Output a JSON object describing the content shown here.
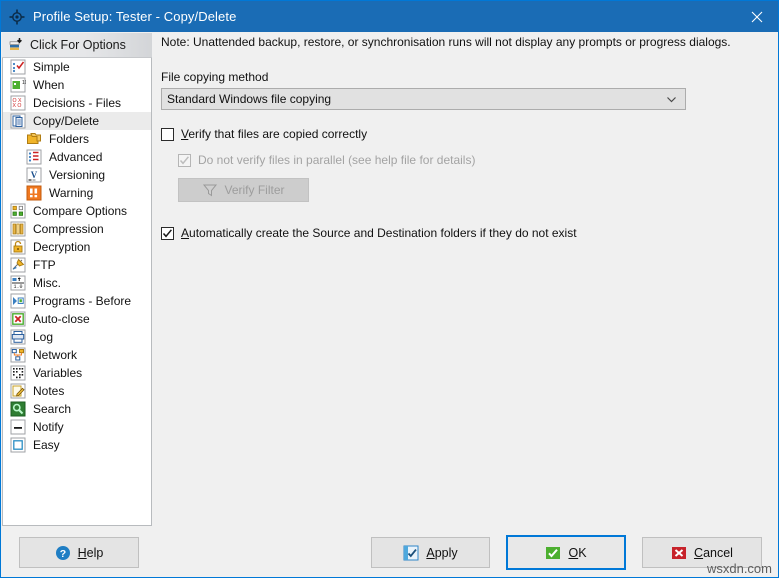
{
  "window": {
    "title": "Profile Setup: Tester - Copy/Delete",
    "title_icon": "app-gear-icon",
    "close_icon": "close-icon",
    "titlebar_color": "#1a6cb5",
    "accent_color": "#0078d7"
  },
  "sidebar": {
    "header": {
      "label": "Click For Options",
      "icon": "options-stack-icon"
    },
    "items": [
      {
        "label": "Simple",
        "icon": "simple-checklist-icon",
        "level": 0,
        "selected": false
      },
      {
        "label": "When",
        "icon": "when-calendar-icon",
        "level": 0,
        "selected": false
      },
      {
        "label": "Decisions - Files",
        "icon": "decisions-grid-icon",
        "level": 0,
        "selected": false
      },
      {
        "label": "Copy/Delete",
        "icon": "copy-delete-icon",
        "level": 0,
        "selected": true
      },
      {
        "label": "Folders",
        "icon": "folders-icon",
        "level": 1,
        "selected": false
      },
      {
        "label": "Advanced",
        "icon": "advanced-list-icon",
        "level": 1,
        "selected": false
      },
      {
        "label": "Versioning",
        "icon": "versioning-v-icon",
        "level": 1,
        "selected": false
      },
      {
        "label": "Warning",
        "icon": "warning-exclaim-icon",
        "level": 1,
        "selected": false
      },
      {
        "label": "Compare Options",
        "icon": "compare-options-icon",
        "level": 0,
        "selected": false
      },
      {
        "label": "Compression",
        "icon": "compression-icon",
        "level": 0,
        "selected": false
      },
      {
        "label": "Decryption",
        "icon": "decryption-lock-icon",
        "level": 0,
        "selected": false
      },
      {
        "label": "FTP",
        "icon": "ftp-icon",
        "level": 0,
        "selected": false
      },
      {
        "label": "Misc.",
        "icon": "misc-icon",
        "level": 0,
        "selected": false
      },
      {
        "label": "Programs - Before",
        "icon": "programs-before-icon",
        "level": 0,
        "selected": false
      },
      {
        "label": "Auto-close",
        "icon": "auto-close-icon",
        "level": 0,
        "selected": false
      },
      {
        "label": "Log",
        "icon": "log-printer-icon",
        "level": 0,
        "selected": false
      },
      {
        "label": "Network",
        "icon": "network-icon",
        "level": 0,
        "selected": false
      },
      {
        "label": "Variables",
        "icon": "variables-dots-icon",
        "level": 0,
        "selected": false
      },
      {
        "label": "Notes",
        "icon": "notes-pencil-icon",
        "level": 0,
        "selected": false
      },
      {
        "label": "Search",
        "icon": "search-magnifier-icon",
        "level": 0,
        "selected": false
      },
      {
        "label": "Notify",
        "icon": "notify-icon",
        "level": 0,
        "selected": false
      },
      {
        "label": "Easy",
        "icon": "easy-square-icon",
        "level": 0,
        "selected": false
      }
    ]
  },
  "main": {
    "note": "Note: Unattended backup, restore, or synchronisation runs will not display any prompts or progress dialogs.",
    "file_copying_method": {
      "label": "File copying method",
      "value": "Standard Windows file copying",
      "chevron_icon": "chevron-down-icon"
    },
    "verify_checkbox": {
      "accel": "V",
      "label_rest": "erify that files are copied correctly",
      "checked": false,
      "enabled": true
    },
    "no_parallel_checkbox": {
      "label": "Do not verify files in parallel (see help file for details)",
      "checked": true,
      "enabled": false
    },
    "verify_filter_button": {
      "label": "Verify Filter",
      "icon": "filter-funnel-icon",
      "enabled": false
    },
    "auto_create_checkbox": {
      "accel": "A",
      "label_rest": "utomatically create the Source and Destination folders if they do not exist",
      "checked": true,
      "enabled": true
    }
  },
  "footer": {
    "help": {
      "accel": "H",
      "pre": "",
      "rest": "elp",
      "icon": "help-question-icon"
    },
    "apply": {
      "accel": "A",
      "pre": "",
      "rest": "pply",
      "icon": "apply-check-icon"
    },
    "ok": {
      "accel": "O",
      "pre": "",
      "rest": "K",
      "icon": "ok-check-icon",
      "default": true
    },
    "cancel": {
      "accel": "C",
      "pre": "",
      "rest": "ancel",
      "icon": "cancel-x-icon"
    }
  },
  "watermark": "wsxdn.com"
}
